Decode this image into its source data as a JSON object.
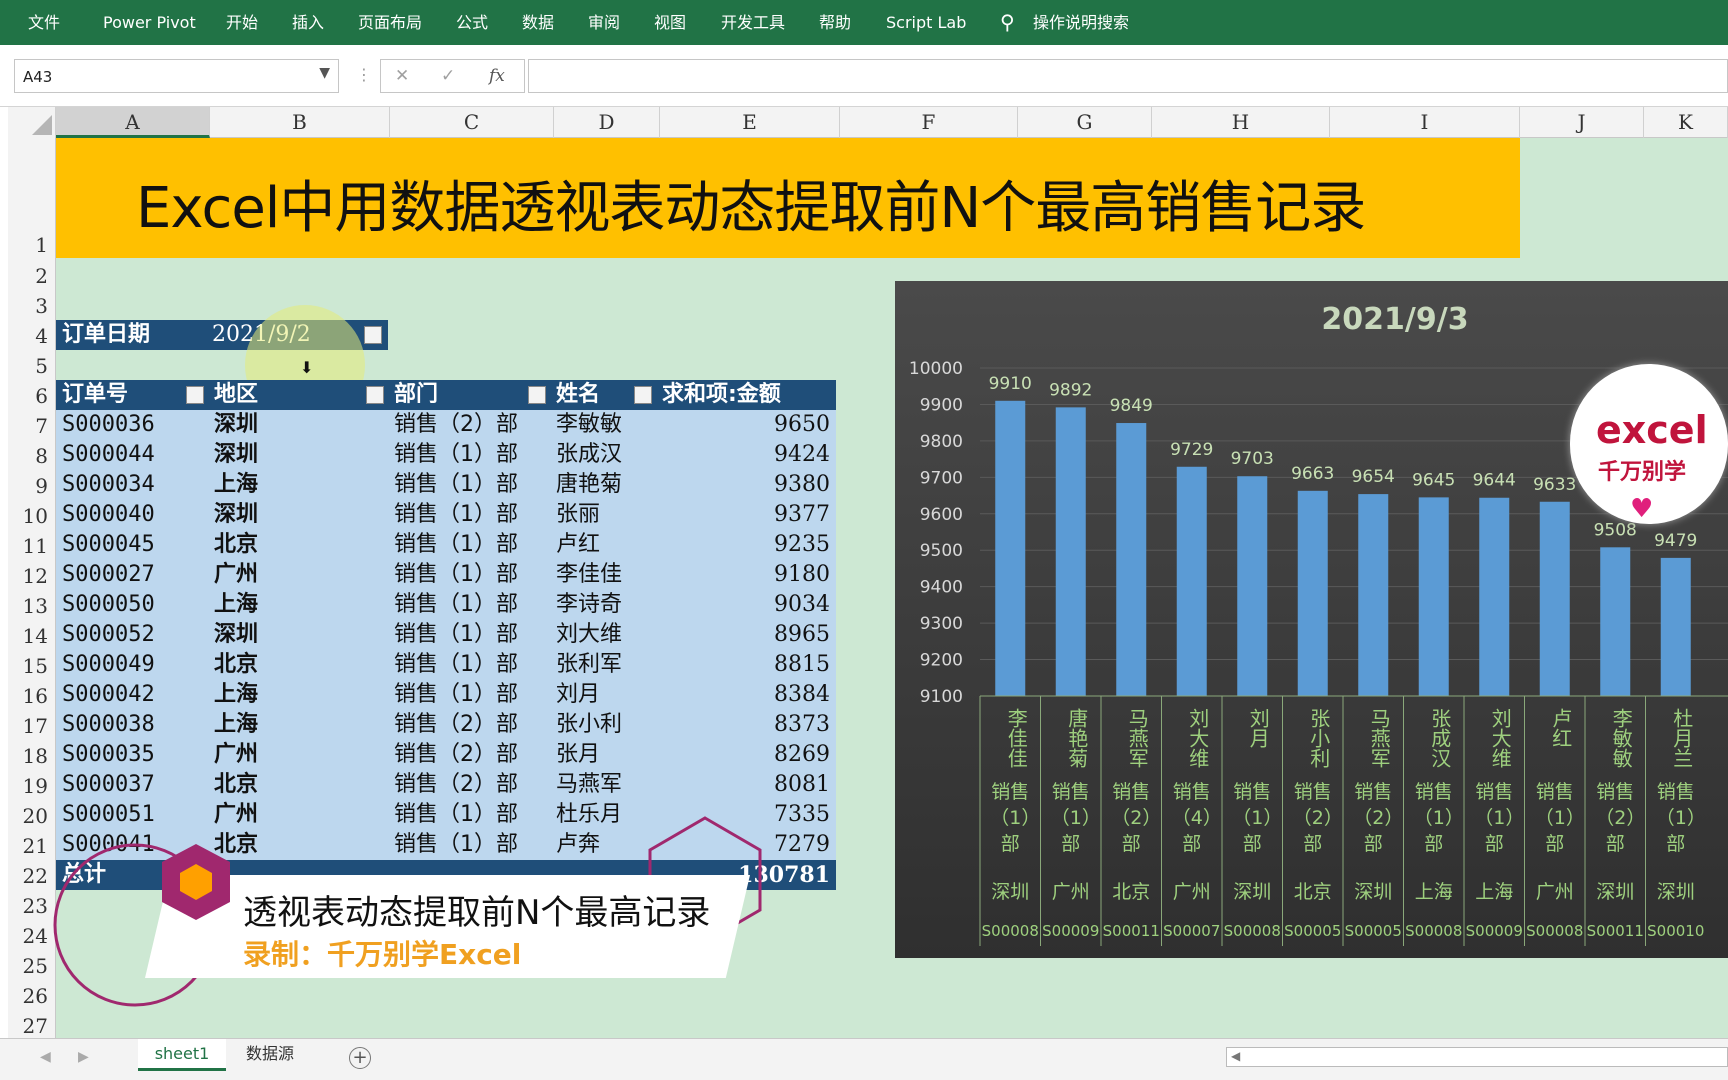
{
  "ribbon": {
    "tabs": [
      "文件",
      "Power Pivot",
      "开始",
      "插入",
      "页面布局",
      "公式",
      "数据",
      "审阅",
      "视图",
      "开发工具",
      "帮助",
      "Script Lab",
      "操作说明搜索"
    ]
  },
  "formula_bar": {
    "name_box": "A43",
    "cancel_symbol": "✕",
    "enter_symbol": "✓",
    "fx_symbol": "fx",
    "formula": ""
  },
  "columns": [
    "A",
    "B",
    "C",
    "D",
    "E",
    "F",
    "G",
    "H",
    "I",
    "J",
    "K"
  ],
  "rows": [
    "1",
    "2",
    "3",
    "4",
    "5",
    "6",
    "7",
    "8",
    "9",
    "10",
    "11",
    "12",
    "13",
    "14",
    "15",
    "16",
    "17",
    "18",
    "19",
    "20",
    "21",
    "22",
    "23",
    "24",
    "25",
    "26",
    "27"
  ],
  "banner": {
    "title": "Excel中用数据透视表动态提取前N个最高销售记录"
  },
  "pivot": {
    "filter_label": "订单日期",
    "filter_value": "2021/9/2",
    "headers": [
      "订单号",
      "地区",
      "部门",
      "姓名",
      "求和项:金额"
    ],
    "rows": [
      [
        "S000036",
        "深圳",
        "销售（2）部",
        "李敏敏",
        "9650"
      ],
      [
        "S000044",
        "深圳",
        "销售（1）部",
        "张成汉",
        "9424"
      ],
      [
        "S000034",
        "上海",
        "销售（1）部",
        "唐艳菊",
        "9380"
      ],
      [
        "S000040",
        "深圳",
        "销售（1）部",
        "张丽",
        "9377"
      ],
      [
        "S000045",
        "北京",
        "销售（1）部",
        "卢红",
        "9235"
      ],
      [
        "S000027",
        "广州",
        "销售（1）部",
        "李佳佳",
        "9180"
      ],
      [
        "S000050",
        "上海",
        "销售（1）部",
        "李诗奇",
        "9034"
      ],
      [
        "S000052",
        "深圳",
        "销售（1）部",
        "刘大维",
        "8965"
      ],
      [
        "S000049",
        "北京",
        "销售（1）部",
        "张利军",
        "8815"
      ],
      [
        "S000042",
        "上海",
        "销售（1）部",
        "刘月",
        "8384"
      ],
      [
        "S000038",
        "上海",
        "销售（2）部",
        "张小利",
        "8373"
      ],
      [
        "S000035",
        "广州",
        "销售（2）部",
        "张月",
        "8269"
      ],
      [
        "S000037",
        "北京",
        "销售（2）部",
        "马燕军",
        "8081"
      ],
      [
        "S000051",
        "广州",
        "销售（1）部",
        "杜乐月",
        "7335"
      ],
      [
        "S000041",
        "北京",
        "销售（1）部",
        "卢奔",
        "7279"
      ]
    ],
    "total_label": "总计",
    "total_value": "130781"
  },
  "chart_data": {
    "type": "bar",
    "title": "2021/9/3",
    "ylim": [
      9100,
      10000
    ],
    "yticks": [
      "10000",
      "9900",
      "9800",
      "9700",
      "9600",
      "9500",
      "9400",
      "9300",
      "9200",
      "9100"
    ],
    "grid": true,
    "categories": [
      {
        "name": "李佳佳",
        "dept": "销售（1）部",
        "region": "深圳",
        "order": "S00008"
      },
      {
        "name": "唐艳菊",
        "dept": "销售（1）部",
        "region": "广州",
        "order": "S00009"
      },
      {
        "name": "马燕军",
        "dept": "销售（2）部",
        "region": "北京",
        "order": "S00011"
      },
      {
        "name": "刘大维",
        "dept": "销售（4）部",
        "region": "广州",
        "order": "S00007"
      },
      {
        "name": "刘月",
        "dept": "销售（1）部",
        "region": "深圳",
        "order": "S00008"
      },
      {
        "name": "张小利",
        "dept": "销售（2）部",
        "region": "北京",
        "order": "S00005"
      },
      {
        "name": "马燕军",
        "dept": "销售（2）部",
        "region": "深圳",
        "order": "S00005"
      },
      {
        "name": "张成汉",
        "dept": "销售（1）部",
        "region": "上海",
        "order": "S00008"
      },
      {
        "name": "刘大维",
        "dept": "销售（1）部",
        "region": "上海",
        "order": "S00009"
      },
      {
        "name": "卢红",
        "dept": "销售（1）部",
        "region": "广州",
        "order": "S00008"
      },
      {
        "name": "李敏敏",
        "dept": "销售（2）部",
        "region": "深圳",
        "order": "S00011"
      },
      {
        "name": "杜月兰",
        "dept": "销售（1）部",
        "region": "深圳",
        "order": "S00010"
      }
    ],
    "values": [
      9910,
      9892,
      9849,
      9729,
      9703,
      9663,
      9654,
      9645,
      9644,
      9633,
      9508,
      9479
    ],
    "value_labels": [
      "9910",
      "9892",
      "9849",
      "9729",
      "9703",
      "9663",
      "9654",
      "9645",
      "9644",
      "9633",
      "9508",
      "9479"
    ],
    "bar_color": "#5b9bd5"
  },
  "logo": {
    "line1": "excel",
    "line2": "千万别学"
  },
  "overlay": {
    "title": "透视表动态提取前N个最高记录",
    "subtitle": "录制：千万别学Excel"
  },
  "sheets": {
    "tabs": [
      "sheet1",
      "数据源"
    ],
    "active": "sheet1",
    "add_symbol": "+"
  },
  "colors": {
    "ribbon": "#217346",
    "banner": "#ffc000",
    "grid_bg": "#cde8d3",
    "pivot_header": "#1f4e79",
    "pivot_row": "#bdd7ee",
    "accent": "#a0286e"
  }
}
